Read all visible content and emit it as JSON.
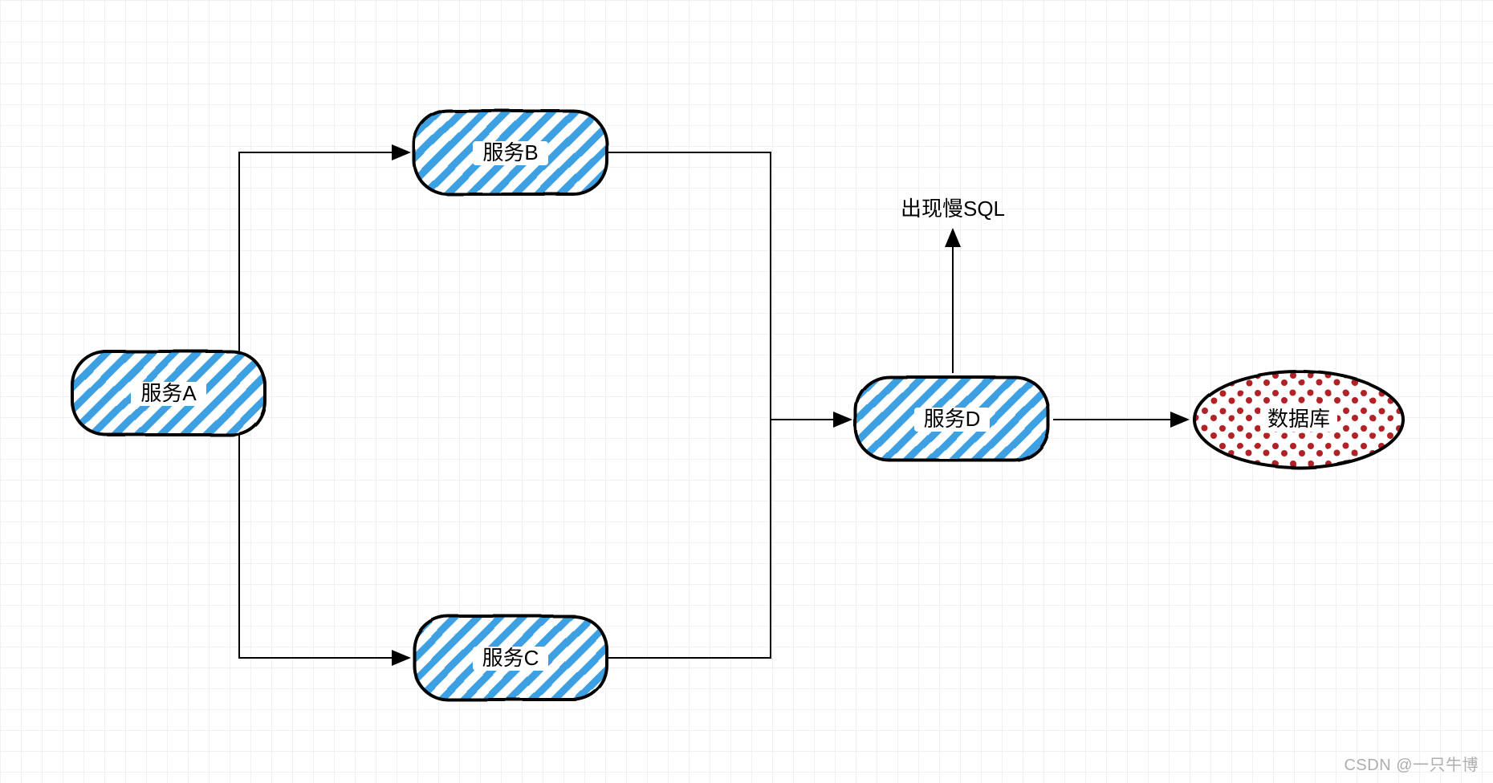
{
  "nodes": {
    "a": {
      "label": "服务A"
    },
    "b": {
      "label": "服务B"
    },
    "c": {
      "label": "服务C"
    },
    "d": {
      "label": "服务D"
    },
    "db": {
      "label": "数据库"
    }
  },
  "annotation": {
    "slow_sql": "出现慢SQL"
  },
  "watermark": "CSDN @一只牛博",
  "colors": {
    "service_fill": "#ffffff",
    "service_hatch": "#3da0e3",
    "service_stroke": "#000000",
    "db_fill": "#ffffff",
    "db_dot": "#b02025",
    "db_stroke": "#000000",
    "arrow": "#000000"
  }
}
